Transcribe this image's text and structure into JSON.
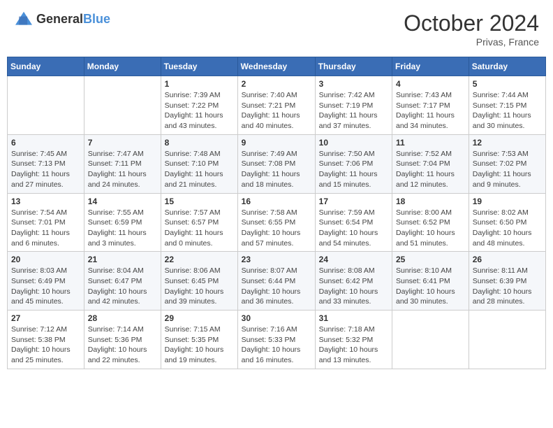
{
  "header": {
    "logo_general": "General",
    "logo_blue": "Blue",
    "month": "October 2024",
    "location": "Privas, France"
  },
  "weekdays": [
    "Sunday",
    "Monday",
    "Tuesday",
    "Wednesday",
    "Thursday",
    "Friday",
    "Saturday"
  ],
  "weeks": [
    [
      {
        "day": "",
        "sunrise": "",
        "sunset": "",
        "daylight": ""
      },
      {
        "day": "",
        "sunrise": "",
        "sunset": "",
        "daylight": ""
      },
      {
        "day": "1",
        "sunrise": "Sunrise: 7:39 AM",
        "sunset": "Sunset: 7:22 PM",
        "daylight": "Daylight: 11 hours and 43 minutes."
      },
      {
        "day": "2",
        "sunrise": "Sunrise: 7:40 AM",
        "sunset": "Sunset: 7:21 PM",
        "daylight": "Daylight: 11 hours and 40 minutes."
      },
      {
        "day": "3",
        "sunrise": "Sunrise: 7:42 AM",
        "sunset": "Sunset: 7:19 PM",
        "daylight": "Daylight: 11 hours and 37 minutes."
      },
      {
        "day": "4",
        "sunrise": "Sunrise: 7:43 AM",
        "sunset": "Sunset: 7:17 PM",
        "daylight": "Daylight: 11 hours and 34 minutes."
      },
      {
        "day": "5",
        "sunrise": "Sunrise: 7:44 AM",
        "sunset": "Sunset: 7:15 PM",
        "daylight": "Daylight: 11 hours and 30 minutes."
      }
    ],
    [
      {
        "day": "6",
        "sunrise": "Sunrise: 7:45 AM",
        "sunset": "Sunset: 7:13 PM",
        "daylight": "Daylight: 11 hours and 27 minutes."
      },
      {
        "day": "7",
        "sunrise": "Sunrise: 7:47 AM",
        "sunset": "Sunset: 7:11 PM",
        "daylight": "Daylight: 11 hours and 24 minutes."
      },
      {
        "day": "8",
        "sunrise": "Sunrise: 7:48 AM",
        "sunset": "Sunset: 7:10 PM",
        "daylight": "Daylight: 11 hours and 21 minutes."
      },
      {
        "day": "9",
        "sunrise": "Sunrise: 7:49 AM",
        "sunset": "Sunset: 7:08 PM",
        "daylight": "Daylight: 11 hours and 18 minutes."
      },
      {
        "day": "10",
        "sunrise": "Sunrise: 7:50 AM",
        "sunset": "Sunset: 7:06 PM",
        "daylight": "Daylight: 11 hours and 15 minutes."
      },
      {
        "day": "11",
        "sunrise": "Sunrise: 7:52 AM",
        "sunset": "Sunset: 7:04 PM",
        "daylight": "Daylight: 11 hours and 12 minutes."
      },
      {
        "day": "12",
        "sunrise": "Sunrise: 7:53 AM",
        "sunset": "Sunset: 7:02 PM",
        "daylight": "Daylight: 11 hours and 9 minutes."
      }
    ],
    [
      {
        "day": "13",
        "sunrise": "Sunrise: 7:54 AM",
        "sunset": "Sunset: 7:01 PM",
        "daylight": "Daylight: 11 hours and 6 minutes."
      },
      {
        "day": "14",
        "sunrise": "Sunrise: 7:55 AM",
        "sunset": "Sunset: 6:59 PM",
        "daylight": "Daylight: 11 hours and 3 minutes."
      },
      {
        "day": "15",
        "sunrise": "Sunrise: 7:57 AM",
        "sunset": "Sunset: 6:57 PM",
        "daylight": "Daylight: 11 hours and 0 minutes."
      },
      {
        "day": "16",
        "sunrise": "Sunrise: 7:58 AM",
        "sunset": "Sunset: 6:55 PM",
        "daylight": "Daylight: 10 hours and 57 minutes."
      },
      {
        "day": "17",
        "sunrise": "Sunrise: 7:59 AM",
        "sunset": "Sunset: 6:54 PM",
        "daylight": "Daylight: 10 hours and 54 minutes."
      },
      {
        "day": "18",
        "sunrise": "Sunrise: 8:00 AM",
        "sunset": "Sunset: 6:52 PM",
        "daylight": "Daylight: 10 hours and 51 minutes."
      },
      {
        "day": "19",
        "sunrise": "Sunrise: 8:02 AM",
        "sunset": "Sunset: 6:50 PM",
        "daylight": "Daylight: 10 hours and 48 minutes."
      }
    ],
    [
      {
        "day": "20",
        "sunrise": "Sunrise: 8:03 AM",
        "sunset": "Sunset: 6:49 PM",
        "daylight": "Daylight: 10 hours and 45 minutes."
      },
      {
        "day": "21",
        "sunrise": "Sunrise: 8:04 AM",
        "sunset": "Sunset: 6:47 PM",
        "daylight": "Daylight: 10 hours and 42 minutes."
      },
      {
        "day": "22",
        "sunrise": "Sunrise: 8:06 AM",
        "sunset": "Sunset: 6:45 PM",
        "daylight": "Daylight: 10 hours and 39 minutes."
      },
      {
        "day": "23",
        "sunrise": "Sunrise: 8:07 AM",
        "sunset": "Sunset: 6:44 PM",
        "daylight": "Daylight: 10 hours and 36 minutes."
      },
      {
        "day": "24",
        "sunrise": "Sunrise: 8:08 AM",
        "sunset": "Sunset: 6:42 PM",
        "daylight": "Daylight: 10 hours and 33 minutes."
      },
      {
        "day": "25",
        "sunrise": "Sunrise: 8:10 AM",
        "sunset": "Sunset: 6:41 PM",
        "daylight": "Daylight: 10 hours and 30 minutes."
      },
      {
        "day": "26",
        "sunrise": "Sunrise: 8:11 AM",
        "sunset": "Sunset: 6:39 PM",
        "daylight": "Daylight: 10 hours and 28 minutes."
      }
    ],
    [
      {
        "day": "27",
        "sunrise": "Sunrise: 7:12 AM",
        "sunset": "Sunset: 5:38 PM",
        "daylight": "Daylight: 10 hours and 25 minutes."
      },
      {
        "day": "28",
        "sunrise": "Sunrise: 7:14 AM",
        "sunset": "Sunset: 5:36 PM",
        "daylight": "Daylight: 10 hours and 22 minutes."
      },
      {
        "day": "29",
        "sunrise": "Sunrise: 7:15 AM",
        "sunset": "Sunset: 5:35 PM",
        "daylight": "Daylight: 10 hours and 19 minutes."
      },
      {
        "day": "30",
        "sunrise": "Sunrise: 7:16 AM",
        "sunset": "Sunset: 5:33 PM",
        "daylight": "Daylight: 10 hours and 16 minutes."
      },
      {
        "day": "31",
        "sunrise": "Sunrise: 7:18 AM",
        "sunset": "Sunset: 5:32 PM",
        "daylight": "Daylight: 10 hours and 13 minutes."
      },
      {
        "day": "",
        "sunrise": "",
        "sunset": "",
        "daylight": ""
      },
      {
        "day": "",
        "sunrise": "",
        "sunset": "",
        "daylight": ""
      }
    ]
  ]
}
